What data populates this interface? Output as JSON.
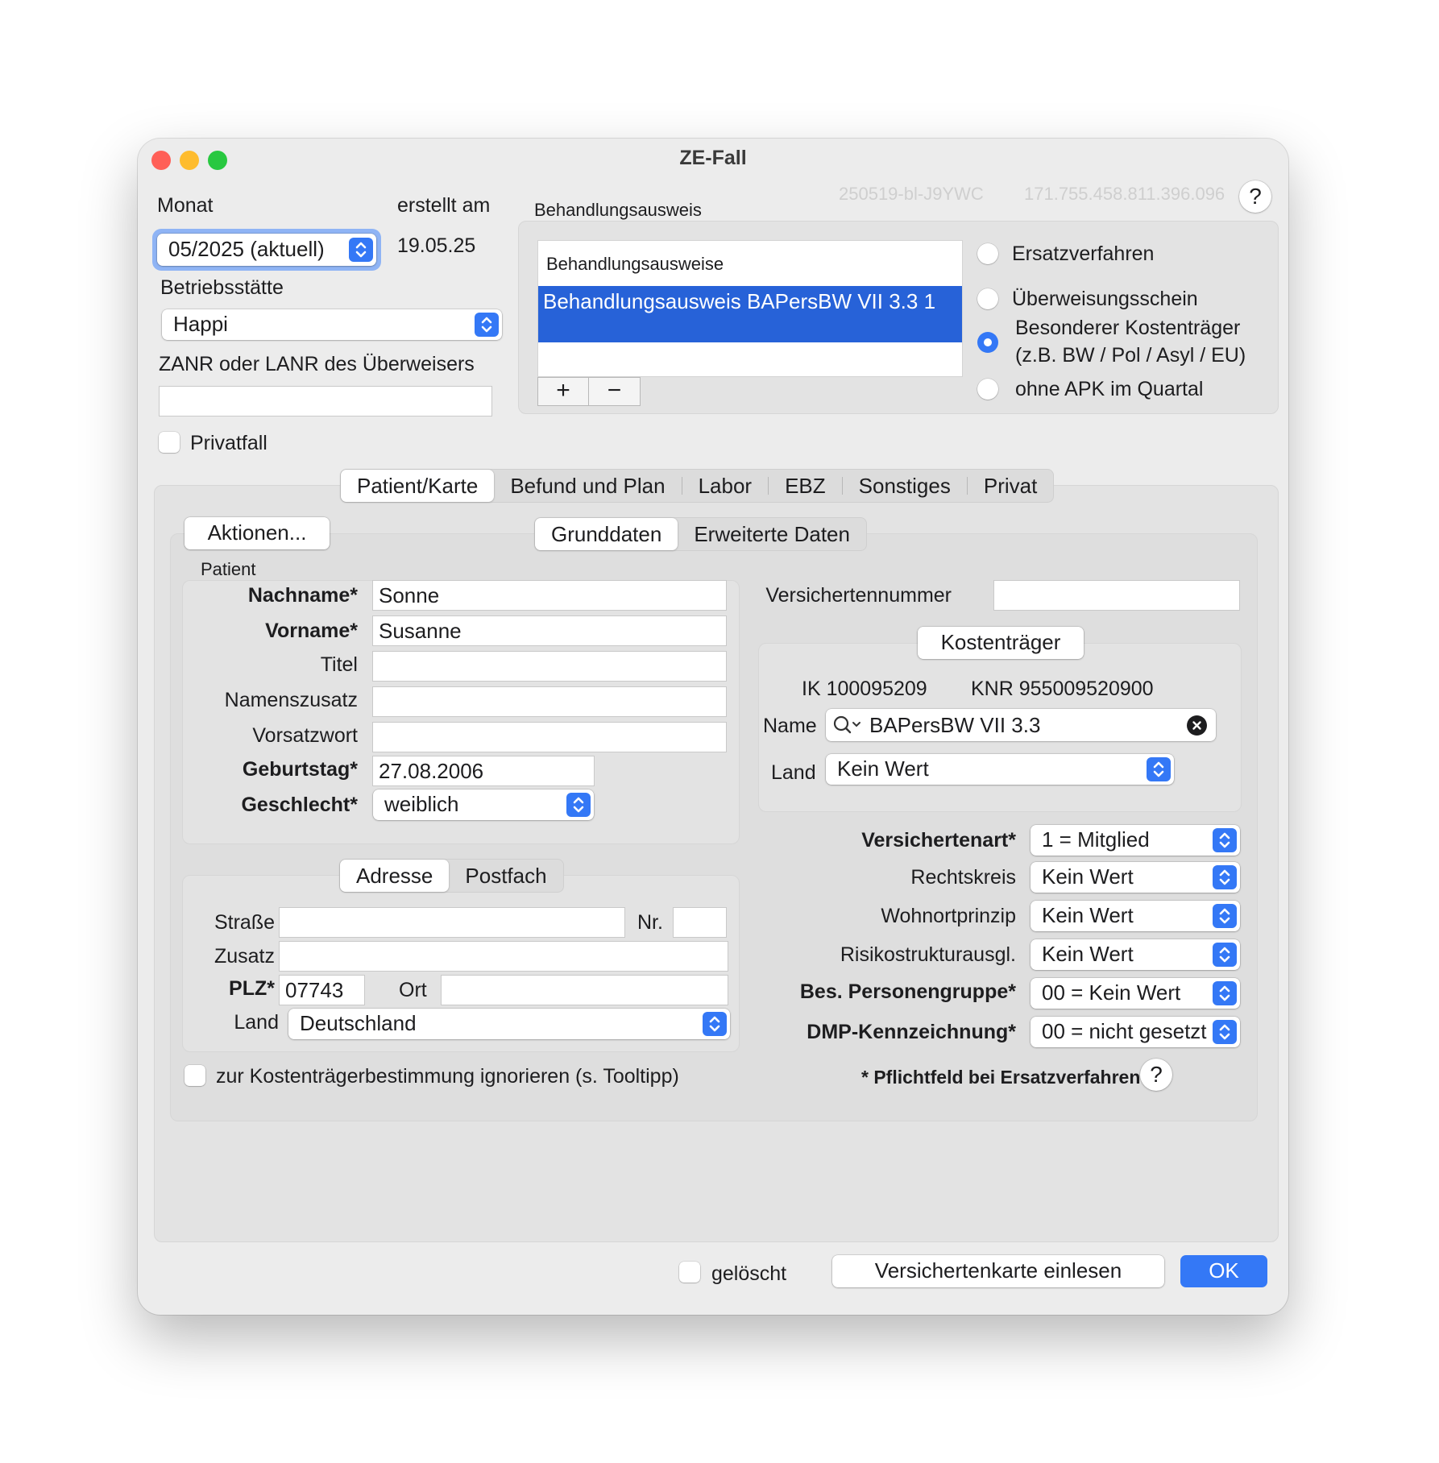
{
  "window": {
    "title": "ZE-Fall",
    "id_code": "250519-bl-J9YWC",
    "id_number": "171.755.458.811.396.096",
    "help": "?"
  },
  "header": {
    "monat_label": "Monat",
    "monat_value": "05/2025 (aktuell)",
    "erstellt_label": "erstellt am",
    "erstellt_value": "19.05.25",
    "betrieb_label": "Betriebsstätte",
    "betrieb_value": "Happi",
    "zanr_label": "ZANR oder LANR des Überweisers",
    "zanr_value": "",
    "privatfall_label": "Privatfall"
  },
  "behandlung": {
    "group_label": "Behandlungsausweis",
    "list_header": "Behandlungsausweise",
    "items": [
      "Behandlungsausweis BAPersBW VII 3.3 1"
    ],
    "add": "+",
    "remove": "−",
    "options": [
      {
        "label": "Ersatzverfahren",
        "selected": false
      },
      {
        "label": "Überweisungsschein",
        "selected": false
      },
      {
        "label": "Besonderer Kostenträger",
        "label2": "(z.B. BW / Pol / Asyl / EU)",
        "selected": true
      },
      {
        "label": "ohne APK im Quartal",
        "selected": false
      }
    ]
  },
  "tabs": [
    "Patient/Karte",
    "Befund und Plan",
    "Labor",
    "EBZ",
    "Sonstiges",
    "Privat"
  ],
  "aktionen": "Aktionen...",
  "subtabs": [
    "Grunddaten",
    "Erweiterte Daten"
  ],
  "patient": {
    "group_label": "Patient",
    "nachname_label": "Nachname*",
    "nachname": "Sonne",
    "vorname_label": "Vorname*",
    "vorname": "Susanne",
    "titel_label": "Titel",
    "titel": "",
    "namenszusatz_label": "Namenszusatz",
    "namenszusatz": "",
    "vorsatzwort_label": "Vorsatzwort",
    "vorsatzwort": "",
    "geburtstag_label": "Geburtstag*",
    "geburtstag": "27.08.2006",
    "geschlecht_label": "Geschlecht*",
    "geschlecht": "weiblich"
  },
  "address_tabs": [
    "Adresse",
    "Postfach"
  ],
  "address": {
    "strasse_label": "Straße",
    "strasse": "",
    "nr_label": "Nr.",
    "nr": "",
    "zusatz_label": "Zusatz",
    "zusatz": "",
    "plz_label": "PLZ*",
    "plz": "07743",
    "ort_label": "Ort",
    "ort": "",
    "land_label": "Land",
    "land": "Deutschland",
    "ignore_label": "zur Kostenträgerbestimmung ignorieren (s. Tooltipp)"
  },
  "versicherung": {
    "nummer_label": "Versichertennummer",
    "nummer": "",
    "kostentraeger_btn": "Kostenträger",
    "ik": "IK 100095209",
    "knr": "KNR 955009520900",
    "name_label": "Name",
    "name_value": "BAPersBW VII 3.3",
    "land_label": "Land",
    "land_value": "Kein Wert",
    "rows": [
      {
        "label": "Versichertenart*",
        "value": "1 = Mitglied",
        "bold": true
      },
      {
        "label": "Rechtskreis",
        "value": "Kein Wert",
        "bold": false
      },
      {
        "label": "Wohnortprinzip",
        "value": "Kein Wert",
        "bold": false
      },
      {
        "label": "Risikostrukturausgl.",
        "value": "Kein Wert",
        "bold": false
      },
      {
        "label": "Bes. Personengruppe*",
        "value": "00 = Kein Wert",
        "bold": true
      },
      {
        "label": "DMP-Kennzeichnung*",
        "value": "00 = nicht gesetzt",
        "bold": true
      }
    ],
    "pflicht_note": "* Pflichtfeld bei Ersatzverfahren",
    "help": "?"
  },
  "footer": {
    "geloescht_label": "gelöscht",
    "einlesen_btn": "Versichertenkarte einlesen",
    "ok_btn": "OK"
  },
  "colors": {
    "accent": "#3478f6",
    "selection": "#2762d8",
    "close": "#ff5f57",
    "minimize": "#febc2e",
    "zoom": "#28c840"
  }
}
